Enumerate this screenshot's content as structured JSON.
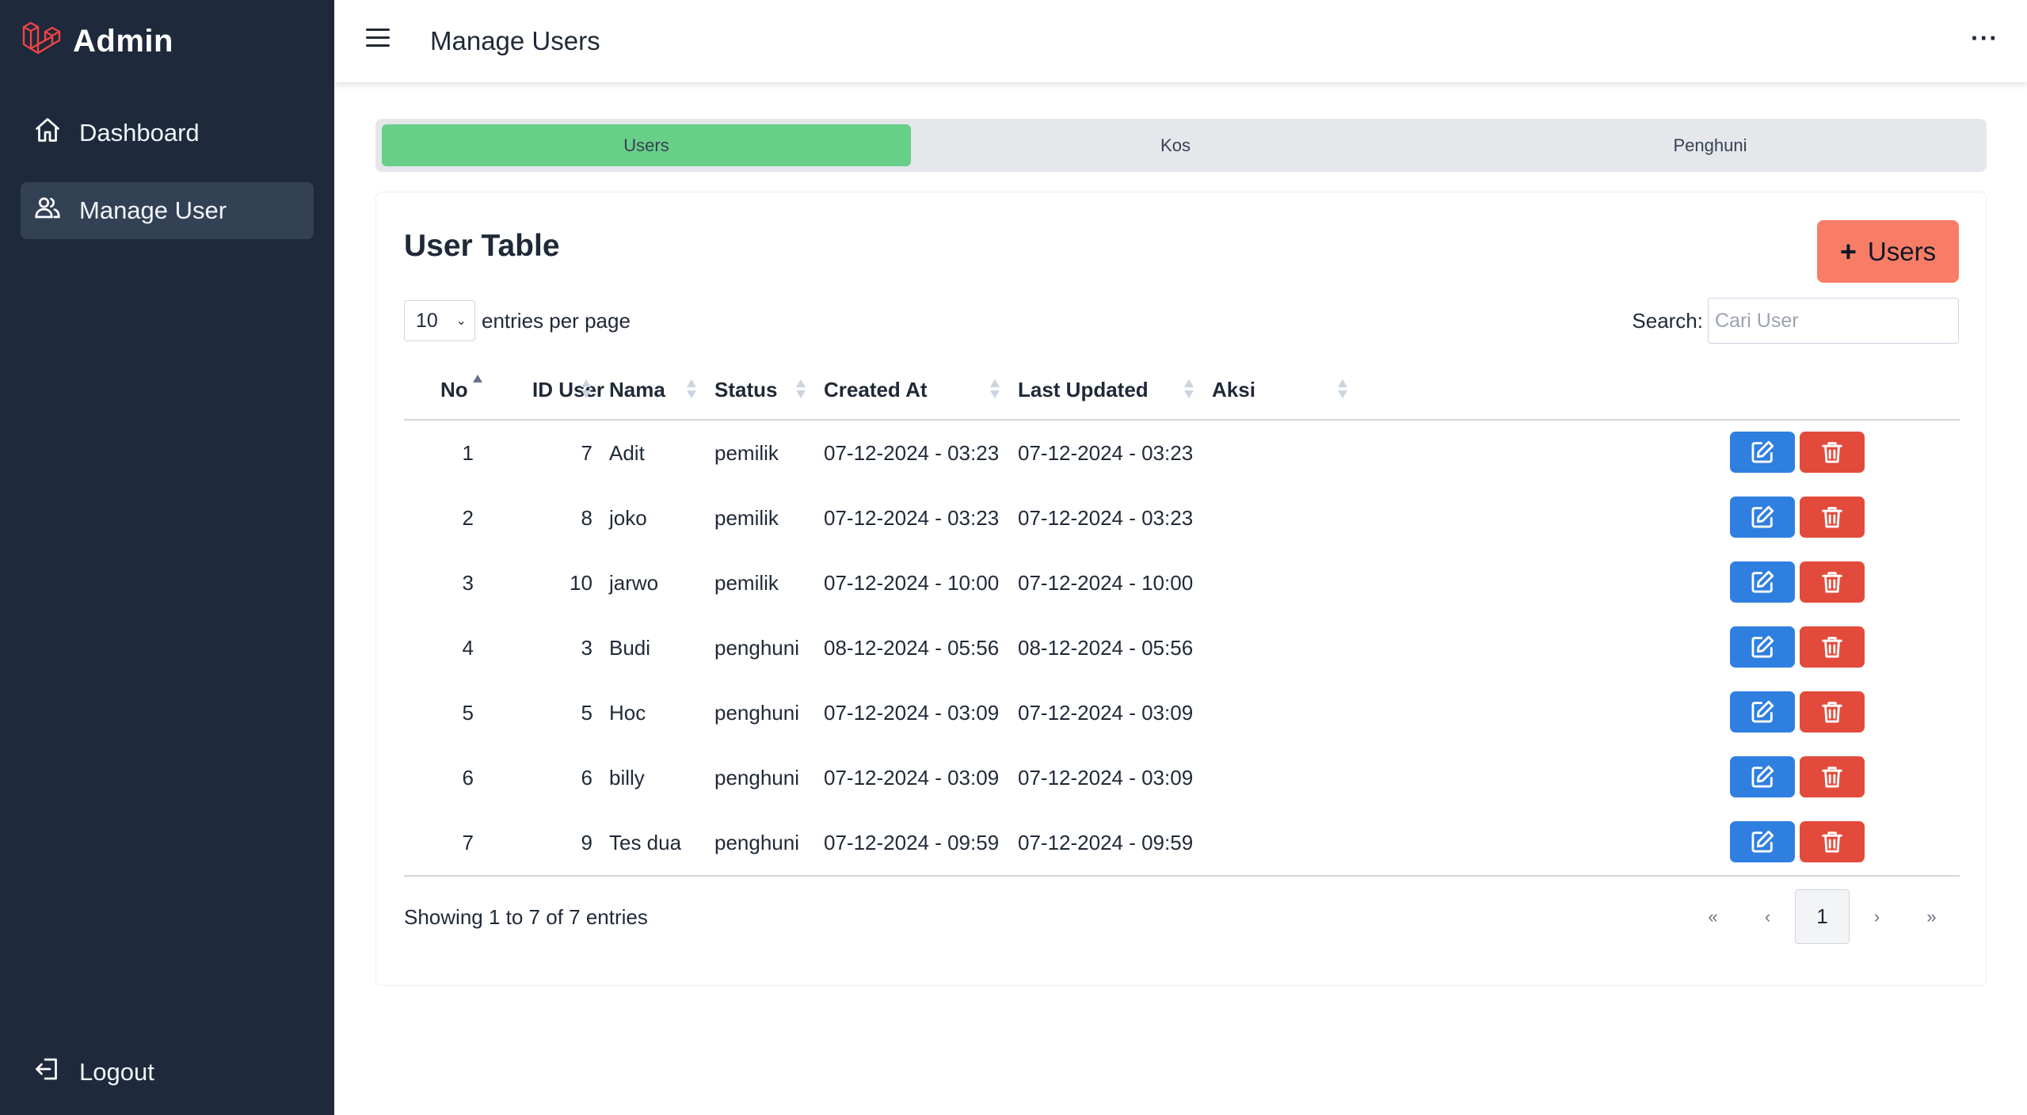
{
  "sidebar": {
    "brand": "Admin",
    "items": [
      {
        "label": "Dashboard",
        "icon": "home-icon"
      },
      {
        "label": "Manage User",
        "icon": "users-icon"
      }
    ],
    "logout": {
      "label": "Logout",
      "icon": "logout-icon"
    }
  },
  "header": {
    "title": "Manage Users",
    "more": "···"
  },
  "tabs": [
    {
      "label": "Users",
      "active": true
    },
    {
      "label": "Kos",
      "active": false
    },
    {
      "label": "Penghuni",
      "active": false
    }
  ],
  "card": {
    "title": "User Table",
    "add_button": "Users",
    "add_icon": "+",
    "entries_value": "10",
    "entries_label": "entries per page",
    "search_label": "Search:",
    "search_placeholder": "Cari User"
  },
  "table": {
    "columns": [
      "No",
      "ID User",
      "Nama",
      "Status",
      "Created At",
      "Last Updated",
      "Aksi"
    ],
    "rows": [
      {
        "no": "1",
        "id": "7",
        "nama": "Adit",
        "status": "pemilik",
        "created": "07-12-2024 - 03:23",
        "updated": "07-12-2024 - 03:23"
      },
      {
        "no": "2",
        "id": "8",
        "nama": "joko",
        "status": "pemilik",
        "created": "07-12-2024 - 03:23",
        "updated": "07-12-2024 - 03:23"
      },
      {
        "no": "3",
        "id": "10",
        "nama": "jarwo",
        "status": "pemilik",
        "created": "07-12-2024 - 10:00",
        "updated": "07-12-2024 - 10:00"
      },
      {
        "no": "4",
        "id": "3",
        "nama": "Budi",
        "status": "penghuni",
        "created": "08-12-2024 - 05:56",
        "updated": "08-12-2024 - 05:56"
      },
      {
        "no": "5",
        "id": "5",
        "nama": "Hoc",
        "status": "penghuni",
        "created": "07-12-2024 - 03:09",
        "updated": "07-12-2024 - 03:09"
      },
      {
        "no": "6",
        "id": "6",
        "nama": "billy",
        "status": "penghuni",
        "created": "07-12-2024 - 03:09",
        "updated": "07-12-2024 - 03:09"
      },
      {
        "no": "7",
        "id": "9",
        "nama": "Tes dua",
        "status": "penghuni",
        "created": "07-12-2024 - 09:59",
        "updated": "07-12-2024 - 09:59"
      }
    ]
  },
  "footer": {
    "info": "Showing 1 to 7 of 7 entries",
    "pager": {
      "first": "«",
      "prev": "‹",
      "current": "1",
      "next": "›",
      "last": "»"
    }
  },
  "colors": {
    "sidebar_bg": "#1e293b",
    "active_tab": "#68cf89",
    "add_button": "#f87d66",
    "edit_button": "#2f7fe0",
    "delete_button": "#e24b3b",
    "brand_logo": "#ef4444"
  }
}
